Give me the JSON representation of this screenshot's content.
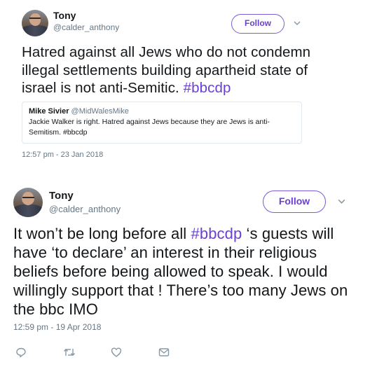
{
  "tweet1": {
    "name": "Tony",
    "handle": "@calder_anthony",
    "follow_label": "Follow",
    "text_main": "Hatred against all Jews who do not condemn illegal settlements building apartheid state of israel is not anti-Semitic.",
    "hashtag": "#bbcdp",
    "quoted": {
      "name": "Mike Sivier",
      "handle": "@MidWalesMike",
      "text": "Jackie Walker is right. Hatred against Jews because they are Jews is anti-Semitism. #bbcdp"
    },
    "timestamp": "12:57 pm - 23 Jan 2018"
  },
  "tweet2": {
    "name": "Tony",
    "handle": "@calder_anthony",
    "follow_label": "Follow",
    "text_before": "It won’t be long before all",
    "hashtag": "#bbcdp",
    "text_after": "‘s guests will have ‘to declare’ an interest in their religious beliefs before being allowed to speak. I would willingly support that ! There’s too many Jews on the bbc IMO",
    "timestamp": "12:59 pm - 19 Apr 2018"
  },
  "colors": {
    "accent": "#6b3fd4",
    "secondary_text": "#657786",
    "border": "#e1e8ed"
  },
  "icons": [
    "chevron-down-icon",
    "reply-icon",
    "retweet-icon",
    "like-icon",
    "direct-message-icon"
  ]
}
